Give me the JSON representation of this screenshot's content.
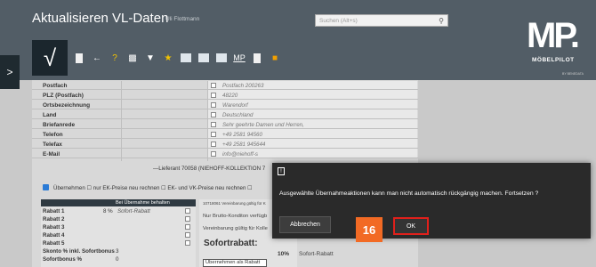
{
  "header": {
    "title": "Aktualisieren VL-Daten",
    "user": "Uli Flottmann",
    "search_placeholder": "Suchen (Alt+s)",
    "logo_mark": "MP.",
    "logo_name": "MÖBELPILOT",
    "logo_sub": "BY BENEDATA",
    "side_tab_glyph": ">",
    "toolbar": {
      "confirm_glyph": "√",
      "back_glyph": "←",
      "help_glyph": "?",
      "mp_label": "MP"
    }
  },
  "form": {
    "rows": [
      {
        "label": "Postfach",
        "value": "Postfach 200263"
      },
      {
        "label": "PLZ (Postfach)",
        "value": "48220"
      },
      {
        "label": "Ortsbezeichnung",
        "value": "Warendorf"
      },
      {
        "label": "Land",
        "value": "Deutschland"
      },
      {
        "label": "Briefanrede",
        "value": "Sehr geehrte Damen und Herren,"
      },
      {
        "label": "Telefon",
        "value": "+49 2581 94560"
      },
      {
        "label": "Telefax",
        "value": "+49 2581 945644"
      },
      {
        "label": "E-Mail",
        "value": "info@niehoff-s"
      }
    ],
    "lieferant_text": "—Lieferant 70058 (NIEHOFF-KOLLEKTION 7",
    "uebernahme_text": "Übernehmen ☐  nur EK-Preise neu rechnen ☐  EK- und VK-Preise neu rechnen ☐",
    "rabatt_header": "Bei Übernahme behalten",
    "rabatt_rows": [
      {
        "label": "Rabatt 1",
        "pct": "8 %",
        "value": "Sofort-Rabatt"
      },
      {
        "label": "Rabatt 2",
        "pct": "",
        "value": ""
      },
      {
        "label": "Rabatt 3",
        "pct": "",
        "value": ""
      },
      {
        "label": "Rabatt 4",
        "pct": "",
        "value": ""
      },
      {
        "label": "Rabatt 5",
        "pct": "",
        "value": ""
      },
      {
        "label": "Skonto % inkl. Sofortbonus",
        "pct": "3",
        "value": ""
      },
      {
        "label": "Sofortbonus %",
        "pct": "0",
        "value": ""
      }
    ],
    "mid_lines": [
      "10718061 Vereinbarung gültig für K",
      "Nur Brutto-Konditon verfügb",
      "Vereinbarung gültig für Kolle"
    ],
    "sofortrabatt_title": "Sofortrabatt:",
    "sofortrabatt_pct": "10%",
    "sofortrabatt_label": "Sofort-Rabatt",
    "uebernehmen_button": "Übernehmen als Rabatt"
  },
  "dialog": {
    "icon_glyph": "!",
    "message": "Ausgewählte Übernahmeaktionen kann man nicht automatisch rückgängig machen. Fortsetzen ?",
    "cancel_label": "Abbrechen",
    "ok_label": "OK",
    "step_badge": "16"
  }
}
